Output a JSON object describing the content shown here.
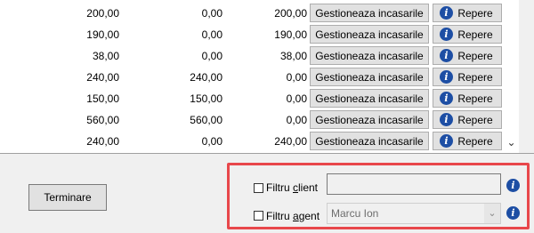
{
  "grid": {
    "rows": [
      {
        "col1": "200,00",
        "col2": "0,00",
        "col3": "200,00",
        "action": "Gestioneaza incasarile",
        "repere": "Repere"
      },
      {
        "col1": "190,00",
        "col2": "0,00",
        "col3": "190,00",
        "action": "Gestioneaza incasarile",
        "repere": "Repere"
      },
      {
        "col1": "38,00",
        "col2": "0,00",
        "col3": "38,00",
        "action": "Gestioneaza incasarile",
        "repere": "Repere"
      },
      {
        "col1": "240,00",
        "col2": "240,00",
        "col3": "0,00",
        "action": "Gestioneaza incasarile",
        "repere": "Repere"
      },
      {
        "col1": "150,00",
        "col2": "150,00",
        "col3": "0,00",
        "action": "Gestioneaza incasarile",
        "repere": "Repere"
      },
      {
        "col1": "560,00",
        "col2": "560,00",
        "col3": "0,00",
        "action": "Gestioneaza incasarile",
        "repere": "Repere"
      },
      {
        "col1": "240,00",
        "col2": "0,00",
        "col3": "240,00",
        "action": "Gestioneaza incasarile",
        "repere": "Repere"
      }
    ],
    "scroll_down_glyph": "⌄",
    "info_glyph": "i"
  },
  "footer": {
    "terminare_label": "Terminare",
    "filters": {
      "client": {
        "label_prefix": "Filtru ",
        "label_accel": "c",
        "label_rest": "lient",
        "checked": false,
        "value": ""
      },
      "agent": {
        "label_prefix": "Filtru ",
        "label_accel": "a",
        "label_rest": "gent",
        "checked": false,
        "value": "Marcu Ion",
        "dropdown_glyph": "⌄"
      }
    }
  },
  "colors": {
    "highlight": "#e8474b",
    "info": "#1d4ea4"
  }
}
